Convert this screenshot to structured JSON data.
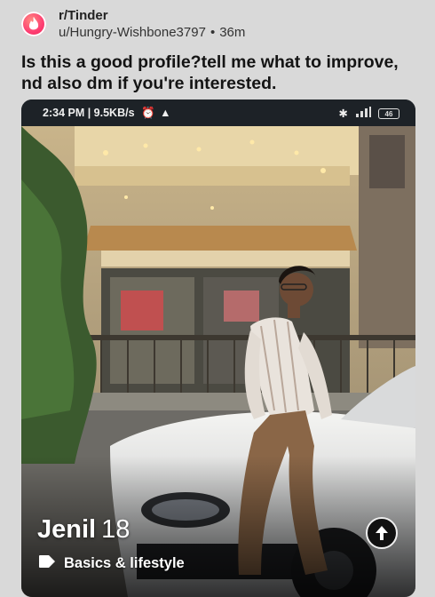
{
  "post": {
    "subreddit": "r/Tinder",
    "author": "u/Hungry-Wishbone3797",
    "separator": "•",
    "age": "36m",
    "title": "Is this a good profile?tell me what to improve, nd also dm if you're interested."
  },
  "phone": {
    "status_left": "2:34 PM | 9.5KB/s",
    "battery": "46",
    "icons": [
      "alarm-icon",
      "notification-icon",
      "bluetooth-icon",
      "signal-icon",
      "battery-icon"
    ]
  },
  "profile": {
    "name": "Jenil",
    "age": "18",
    "lifestyle_label": "Basics & lifestyle",
    "icons": [
      "tag-icon",
      "arrow-up-icon"
    ]
  },
  "colors": {
    "tinder": "#fe3c72",
    "background": "#d9d9d9"
  }
}
